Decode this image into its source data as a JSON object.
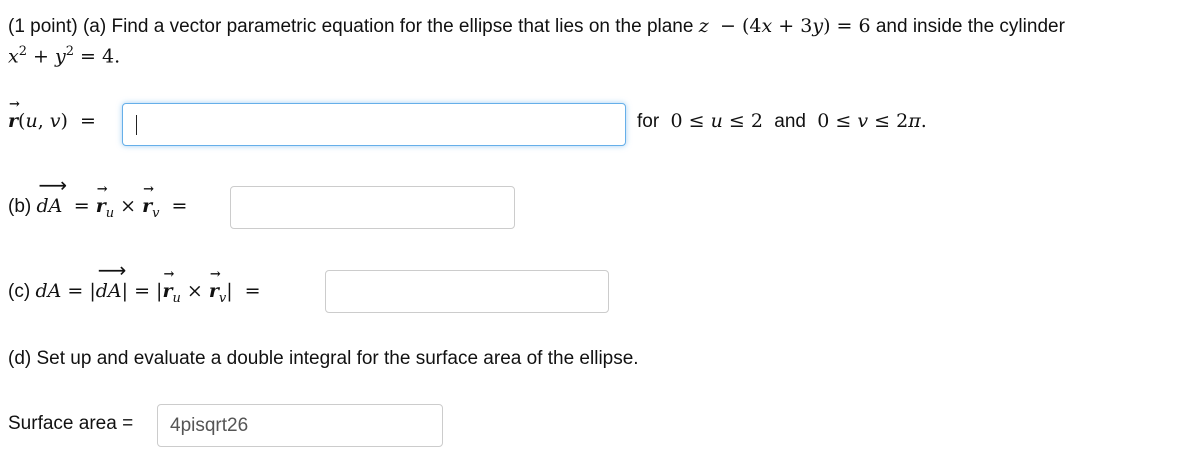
{
  "question": {
    "intro": "(1 point) (a) Find a vector parametric equation for the ellipse that lies on the plane",
    "and_inside": "and inside the cylinder"
  },
  "part_a": {
    "for_text": "for",
    "and_text": "and",
    "answer": ""
  },
  "part_b": {
    "label": "(b)",
    "answer": ""
  },
  "part_c": {
    "label": "(c)",
    "answer": ""
  },
  "part_d": {
    "text": "(d) Set up and evaluate a double integral for the surface area of the ellipse."
  },
  "surface_area": {
    "label": "Surface area =",
    "answer": "4pisqrt26"
  },
  "colors": {
    "focus_border": "#66afe9",
    "input_border": "#cccccc"
  }
}
